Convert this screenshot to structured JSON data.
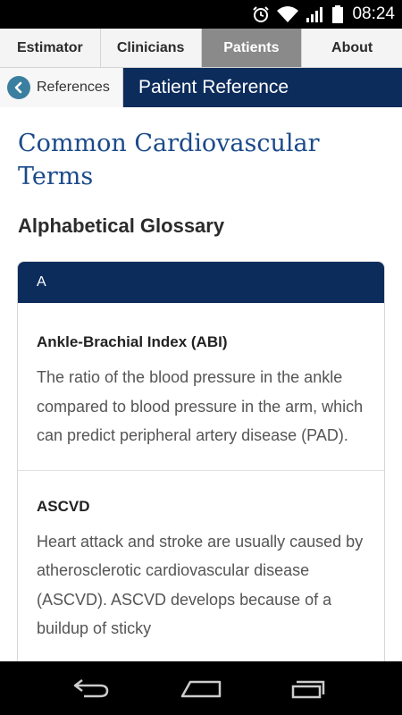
{
  "status_bar": {
    "time": "08:24"
  },
  "tabs": [
    {
      "label": "Estimator",
      "active": false
    },
    {
      "label": "Clinicians",
      "active": false
    },
    {
      "label": "Patients",
      "active": true
    },
    {
      "label": "About",
      "active": false
    }
  ],
  "header": {
    "back_label": "References",
    "title": "Patient Reference"
  },
  "page": {
    "title": "Common Cardiovascular Terms",
    "section_title": "Alphabetical Glossary"
  },
  "glossary": {
    "letter": "A",
    "terms": [
      {
        "name": "Ankle-Brachial Index (ABI)",
        "definition": "The ratio of the blood pressure in the ankle compared to blood pressure in the arm, which can predict peripheral artery disease (PAD)."
      },
      {
        "name": "ASCVD",
        "definition": "Heart attack and stroke are usually caused by atherosclerotic cardiovascular disease (ASCVD). ASCVD develops because of a buildup of sticky"
      }
    ]
  },
  "colors": {
    "navy": "#0c2c5c",
    "title_blue": "#1b4a8a",
    "back_circle": "#3b7fa0",
    "active_tab": "#8a8a8a"
  },
  "icons": [
    "alarm-icon",
    "wifi-icon",
    "signal-icon",
    "battery-icon",
    "back-arrow-icon",
    "nav-back-icon",
    "nav-home-icon",
    "nav-recents-icon"
  ]
}
